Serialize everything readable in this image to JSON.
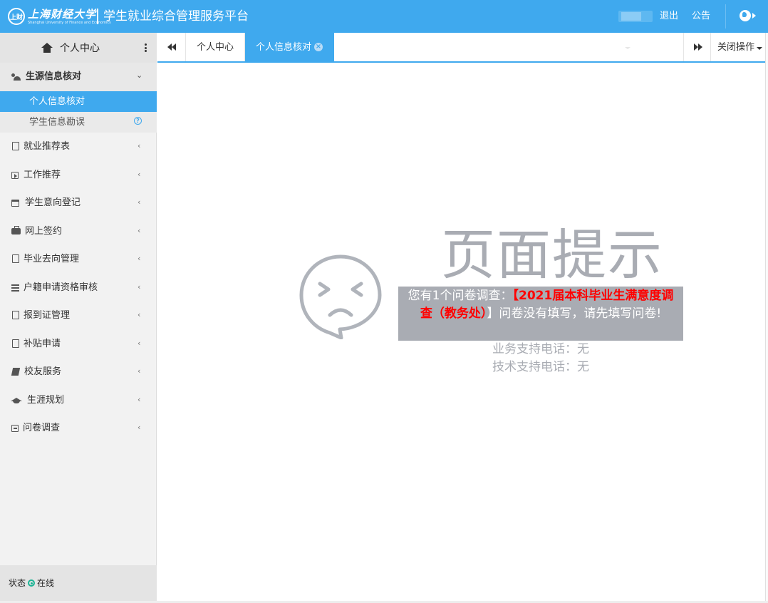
{
  "header": {
    "logo_seal_text": "上财",
    "logo_text": "上海财经大学",
    "logo_subtitle": "Shanghai University of Finance and Economics",
    "platform_title": "学生就业综合管理服务平台",
    "logout_label": "退出",
    "notice_label": "公告",
    "user_icon": "globe-icon"
  },
  "sidebar": {
    "head_title": "个人中心",
    "groups": [
      {
        "label": "生源信息核对",
        "icon": "users-icon",
        "open": true,
        "items": [
          {
            "label": "个人信息核对",
            "active": true
          },
          {
            "label": "学生信息勘误",
            "active": false,
            "icon": "question-circle-icon"
          }
        ]
      },
      {
        "label": "就业推荐表",
        "icon": "file-icon"
      },
      {
        "label": "工作推荐",
        "icon": "play-square-icon"
      },
      {
        "label": "学生意向登记",
        "icon": "calendar-icon"
      },
      {
        "label": "网上签约",
        "icon": "briefcase-icon"
      },
      {
        "label": "毕业去向管理",
        "icon": "file-icon"
      },
      {
        "label": "户籍申请资格审核",
        "icon": "bars-icon"
      },
      {
        "label": "报到证管理",
        "icon": "file-icon"
      },
      {
        "label": "补贴申请",
        "icon": "file-icon"
      },
      {
        "label": "校友服务",
        "icon": "book-icon"
      },
      {
        "label": "生涯规划",
        "icon": "graduation-cap-icon"
      },
      {
        "label": "问卷调查",
        "icon": "minus-square-icon"
      }
    ],
    "status": {
      "label": "状态",
      "value": "在线",
      "color": "#1ab394"
    }
  },
  "tabs": {
    "items": [
      {
        "label": "个人中心",
        "active": false
      },
      {
        "label": "个人信息核对",
        "active": true
      }
    ],
    "close_ops_label": "关闭操作"
  },
  "content": {
    "title": "页面提示",
    "notice_prefix": "您有1个问卷调查：",
    "notice_open_bracket": "【",
    "notice_highlight": "2021届本科毕业生满意度调查（教务处）",
    "notice_suffix": "】问卷没有填写，请先填写问卷!",
    "business_phone": "业务支持电话：无",
    "tech_phone": "技术支持电话：无"
  },
  "colors": {
    "accent": "#3fa9ee",
    "muted_text": "#a9acb3",
    "highlight": "#ff0000"
  }
}
